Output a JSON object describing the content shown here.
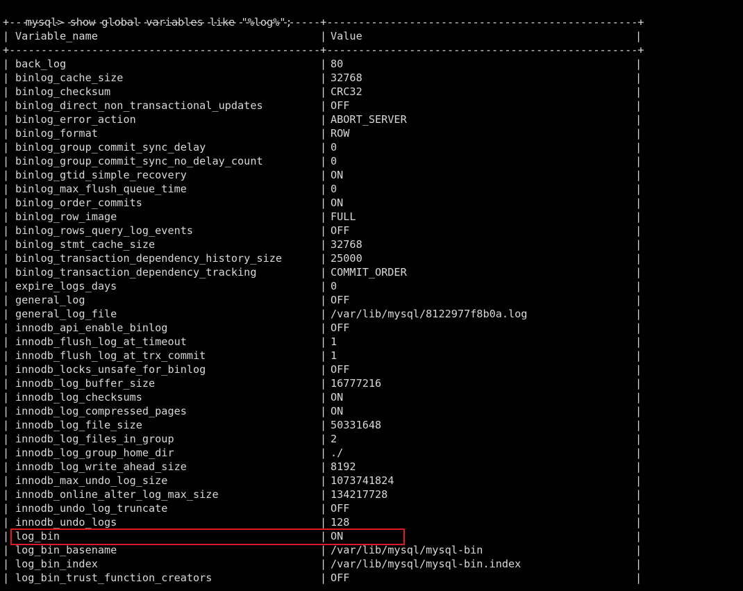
{
  "terminal": {
    "prompt": "mysql> ",
    "command": "show global variables like \"%log%\";",
    "prompt_line": "mysql> show global variables like \"%log%\";",
    "background_color": "#000000",
    "text_color": "#d8d8d8",
    "highlight_color": "#e01b1b"
  },
  "table": {
    "top_rule": "+-----------------------------------------------+-----------------------------------------+",
    "header_rule": "+-----------------------------------------------+-----------------------------------------+",
    "columns": [
      "Variable_name",
      "Value"
    ],
    "pipe": "|",
    "rows": [
      {
        "name": "back_log",
        "value": "80"
      },
      {
        "name": "binlog_cache_size",
        "value": "32768"
      },
      {
        "name": "binlog_checksum",
        "value": "CRC32"
      },
      {
        "name": "binlog_direct_non_transactional_updates",
        "value": "OFF"
      },
      {
        "name": "binlog_error_action",
        "value": "ABORT_SERVER"
      },
      {
        "name": "binlog_format",
        "value": "ROW"
      },
      {
        "name": "binlog_group_commit_sync_delay",
        "value": "0"
      },
      {
        "name": "binlog_group_commit_sync_no_delay_count",
        "value": "0"
      },
      {
        "name": "binlog_gtid_simple_recovery",
        "value": "ON"
      },
      {
        "name": "binlog_max_flush_queue_time",
        "value": "0"
      },
      {
        "name": "binlog_order_commits",
        "value": "ON"
      },
      {
        "name": "binlog_row_image",
        "value": "FULL"
      },
      {
        "name": "binlog_rows_query_log_events",
        "value": "OFF"
      },
      {
        "name": "binlog_stmt_cache_size",
        "value": "32768"
      },
      {
        "name": "binlog_transaction_dependency_history_size",
        "value": "25000"
      },
      {
        "name": "binlog_transaction_dependency_tracking",
        "value": "COMMIT_ORDER"
      },
      {
        "name": "expire_logs_days",
        "value": "0"
      },
      {
        "name": "general_log",
        "value": "OFF"
      },
      {
        "name": "general_log_file",
        "value": "/var/lib/mysql/8122977f8b0a.log"
      },
      {
        "name": "innodb_api_enable_binlog",
        "value": "OFF"
      },
      {
        "name": "innodb_flush_log_at_timeout",
        "value": "1"
      },
      {
        "name": "innodb_flush_log_at_trx_commit",
        "value": "1"
      },
      {
        "name": "innodb_locks_unsafe_for_binlog",
        "value": "OFF"
      },
      {
        "name": "innodb_log_buffer_size",
        "value": "16777216"
      },
      {
        "name": "innodb_log_checksums",
        "value": "ON"
      },
      {
        "name": "innodb_log_compressed_pages",
        "value": "ON"
      },
      {
        "name": "innodb_log_file_size",
        "value": "50331648"
      },
      {
        "name": "innodb_log_files_in_group",
        "value": "2"
      },
      {
        "name": "innodb_log_group_home_dir",
        "value": "./"
      },
      {
        "name": "innodb_log_write_ahead_size",
        "value": "8192"
      },
      {
        "name": "innodb_max_undo_log_size",
        "value": "1073741824"
      },
      {
        "name": "innodb_online_alter_log_max_size",
        "value": "134217728"
      },
      {
        "name": "innodb_undo_log_truncate",
        "value": "OFF"
      },
      {
        "name": "innodb_undo_logs",
        "value": "128"
      },
      {
        "name": "log_bin",
        "value": "ON"
      },
      {
        "name": "log_bin_basename",
        "value": "/var/lib/mysql/mysql-bin"
      },
      {
        "name": "log_bin_index",
        "value": "/var/lib/mysql/mysql-bin.index"
      },
      {
        "name": "log_bin_trust_function_creators",
        "value": "OFF"
      }
    ],
    "highlighted_row_index": 34,
    "highlighted_row_name": "log_bin",
    "highlighted_row_value": "ON"
  }
}
